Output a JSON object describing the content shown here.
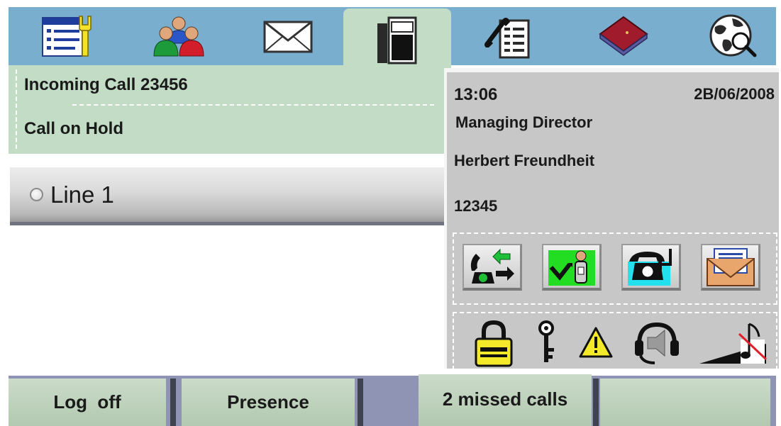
{
  "tabs": [
    {
      "icon": "settings-list-icon"
    },
    {
      "icon": "contacts-icon"
    },
    {
      "icon": "mail-icon"
    },
    {
      "icon": "phone-icon",
      "active": true
    },
    {
      "icon": "call-log-icon"
    },
    {
      "icon": "phonebook-icon"
    },
    {
      "icon": "globe-search-icon"
    }
  ],
  "call_info": {
    "incoming": "Incoming Call 23456",
    "hold": "Call on Hold"
  },
  "line": {
    "label": "Line 1"
  },
  "details": {
    "time": "13:06",
    "date": "2B/06/2008",
    "title": "Managing Director",
    "name": "Herbert Freundheit",
    "number": "12345"
  },
  "actions": [
    {
      "icon": "call-forward-icon"
    },
    {
      "icon": "transfer-to-person-icon"
    },
    {
      "icon": "callback-icon"
    },
    {
      "icon": "message-envelope-icon"
    }
  ],
  "status_icons": [
    {
      "icon": "lock-icon"
    },
    {
      "icon": "key-icon"
    },
    {
      "icon": "warning-icon"
    },
    {
      "icon": "headset-mute-icon"
    },
    {
      "icon": "ringer-volume-off-icon"
    }
  ],
  "bottom_bar": {
    "log_off": "Log  off",
    "presence": "Presence",
    "missed_calls": "2 missed calls",
    "empty": ""
  },
  "colors": {
    "tab_bar": "#7aaecf",
    "active_tab": "#c3dcc5",
    "info_panel": "#c7c7c7",
    "bottom_bar": "#8f94b4",
    "bottom_button": "#c3d6c1"
  }
}
